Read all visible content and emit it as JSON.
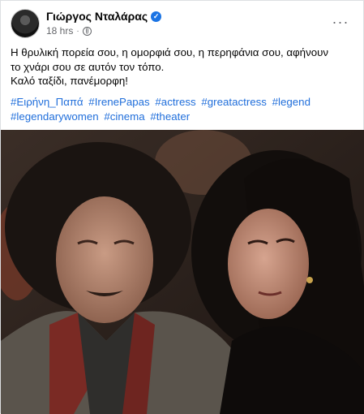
{
  "author": {
    "name": "Γιώργος Νταλάρας",
    "verified": true
  },
  "meta": {
    "time": "18 hrs",
    "separator": "·",
    "audience_icon": "globe-icon"
  },
  "more_label": "···",
  "text_lines": [
    "Η θρυλική πορεία σου, η ομορφιά σου, η περηφάνια σου, αφήνουν",
    "το χνάρι σου σε αυτόν τον τόπο.",
    "Καλό ταξίδι, πανέμορφη!"
  ],
  "hashtags": [
    "#Ειρήνη_Παπά",
    "#IrenePapas",
    "#actress",
    "#greatactress",
    "#legend",
    "#legendarywomen",
    "#cinema",
    "#theater"
  ],
  "colors": {
    "link": "#216fdb",
    "verified_badge": "#1b74e4",
    "meta_text": "#65676b"
  },
  "photo": {
    "description_icon": "photo-of-two-people"
  }
}
